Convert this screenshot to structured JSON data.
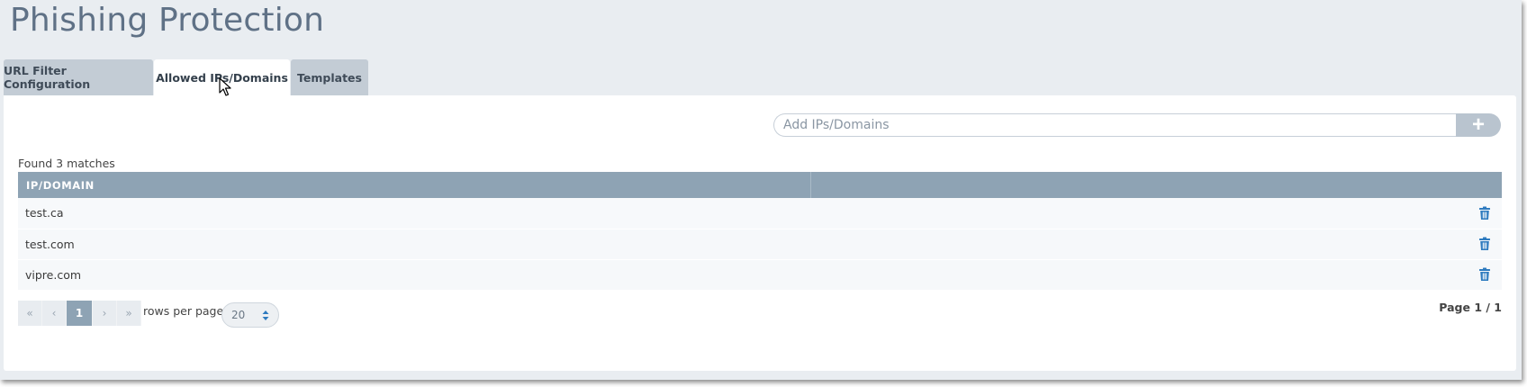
{
  "page_title": "Phishing Protection",
  "tabs": [
    {
      "label": "URL Filter Configuration",
      "active": false
    },
    {
      "label": "Allowed IPs/Domains",
      "active": true
    },
    {
      "label": "Templates",
      "active": false
    }
  ],
  "add_field": {
    "placeholder": "Add IPs/Domains",
    "value": "",
    "button_icon": "plus-icon",
    "button_label": "+"
  },
  "results": {
    "found_text": "Found 3 matches"
  },
  "table": {
    "columns": [
      "IP/DOMAIN",
      ""
    ],
    "rows": [
      {
        "domain": "test.ca",
        "action_icon": "trash-icon"
      },
      {
        "domain": "test.com",
        "action_icon": "trash-icon"
      },
      {
        "domain": "vipre.com",
        "action_icon": "trash-icon"
      }
    ]
  },
  "pagination": {
    "first": "«",
    "prev": "‹",
    "current": "1",
    "next": "›",
    "last": "»",
    "rows_per_page_label": "rows per page",
    "rows_per_page_value": "20",
    "page_info": "Page 1 / 1"
  },
  "colors": {
    "title": "#5f7186",
    "tab_inactive": "#c3ccd5",
    "table_header": "#8ea3b4",
    "trash_icon": "#2e7bbf",
    "background": "#e9edf1"
  }
}
